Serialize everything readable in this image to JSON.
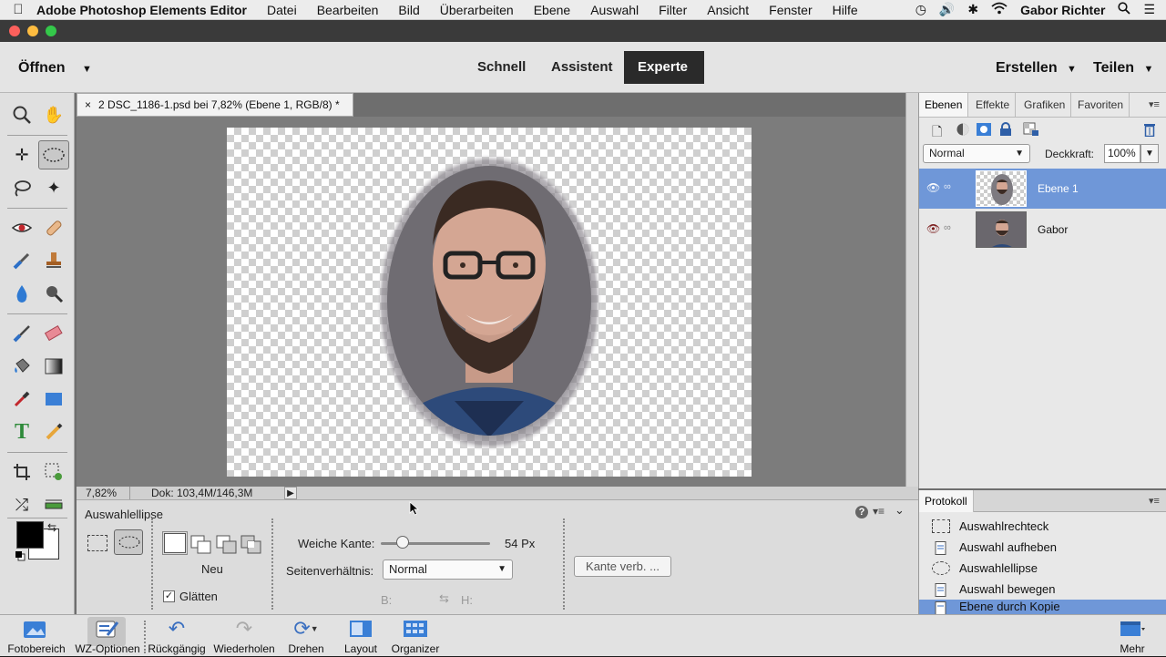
{
  "menubar": {
    "app_name": "Adobe Photoshop Elements Editor",
    "items": [
      "Datei",
      "Bearbeiten",
      "Bild",
      "Überarbeiten",
      "Ebene",
      "Auswahl",
      "Filter",
      "Ansicht",
      "Fenster",
      "Hilfe"
    ],
    "user": "Gabor Richter"
  },
  "modebar": {
    "open_label": "Öffnen",
    "modes": [
      "Schnell",
      "Assistent",
      "Experte"
    ],
    "active_mode": "Experte",
    "create_label": "Erstellen",
    "share_label": "Teilen"
  },
  "document": {
    "tab_title": "2 DSC_1186-1.psd bei 7,82% (Ebene 1, RGB/8) *",
    "zoom": "7,82%",
    "doc_size": "Dok: 103,4M/146,3M"
  },
  "tool_options": {
    "tool_name": "Auswahlellipse",
    "mode_label": "Neu",
    "antialias_label": "Glätten",
    "feather_label": "Weiche Kante:",
    "feather_value": "54 Px",
    "feather_fraction": 0.2,
    "aspect_label": "Seitenverhältnis:",
    "aspect_value": "Normal",
    "width_label": "B:",
    "height_label": "H:",
    "refine_button": "Kante verb. ..."
  },
  "layers_panel": {
    "tabs": [
      "Ebenen",
      "Effekte",
      "Grafiken",
      "Favoriten"
    ],
    "blend_mode": "Normal",
    "opacity_label": "Deckkraft:",
    "opacity_value": "100%",
    "layers": [
      {
        "name": "Ebene 1",
        "selected": true
      },
      {
        "name": "Gabor",
        "selected": false
      }
    ]
  },
  "history_panel": {
    "title": "Protokoll",
    "items": [
      "Auswahlrechteck",
      "Auswahl aufheben",
      "Auswahlellipse",
      "Auswahl bewegen",
      "Ebene durch Kopie"
    ]
  },
  "bottom_bar": {
    "items": [
      "Fotobereich",
      "WZ-Optionen",
      "Rückgängig",
      "Wiederholen",
      "Drehen",
      "Layout",
      "Organizer",
      "Mehr"
    ]
  },
  "colors": {
    "accent": "#5b8bd6",
    "selected_layer": "#6f97d8",
    "mode_active_bg": "#2a2a2a"
  }
}
